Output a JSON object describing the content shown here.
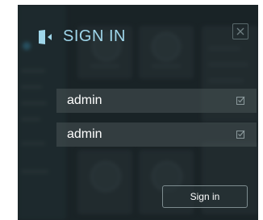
{
  "modal": {
    "title": "SIGN IN",
    "username_value": "admin",
    "password_value": "admin",
    "submit_label": "Sign in"
  },
  "icons": {
    "title": "sign-in-door-icon",
    "close": "close-icon",
    "autofill": "autofill-check-icon"
  },
  "colors": {
    "title": "#9fd6ea",
    "background": "#1e2a2d",
    "field_bg": "#485456",
    "button_border": "#7d8c8f"
  }
}
